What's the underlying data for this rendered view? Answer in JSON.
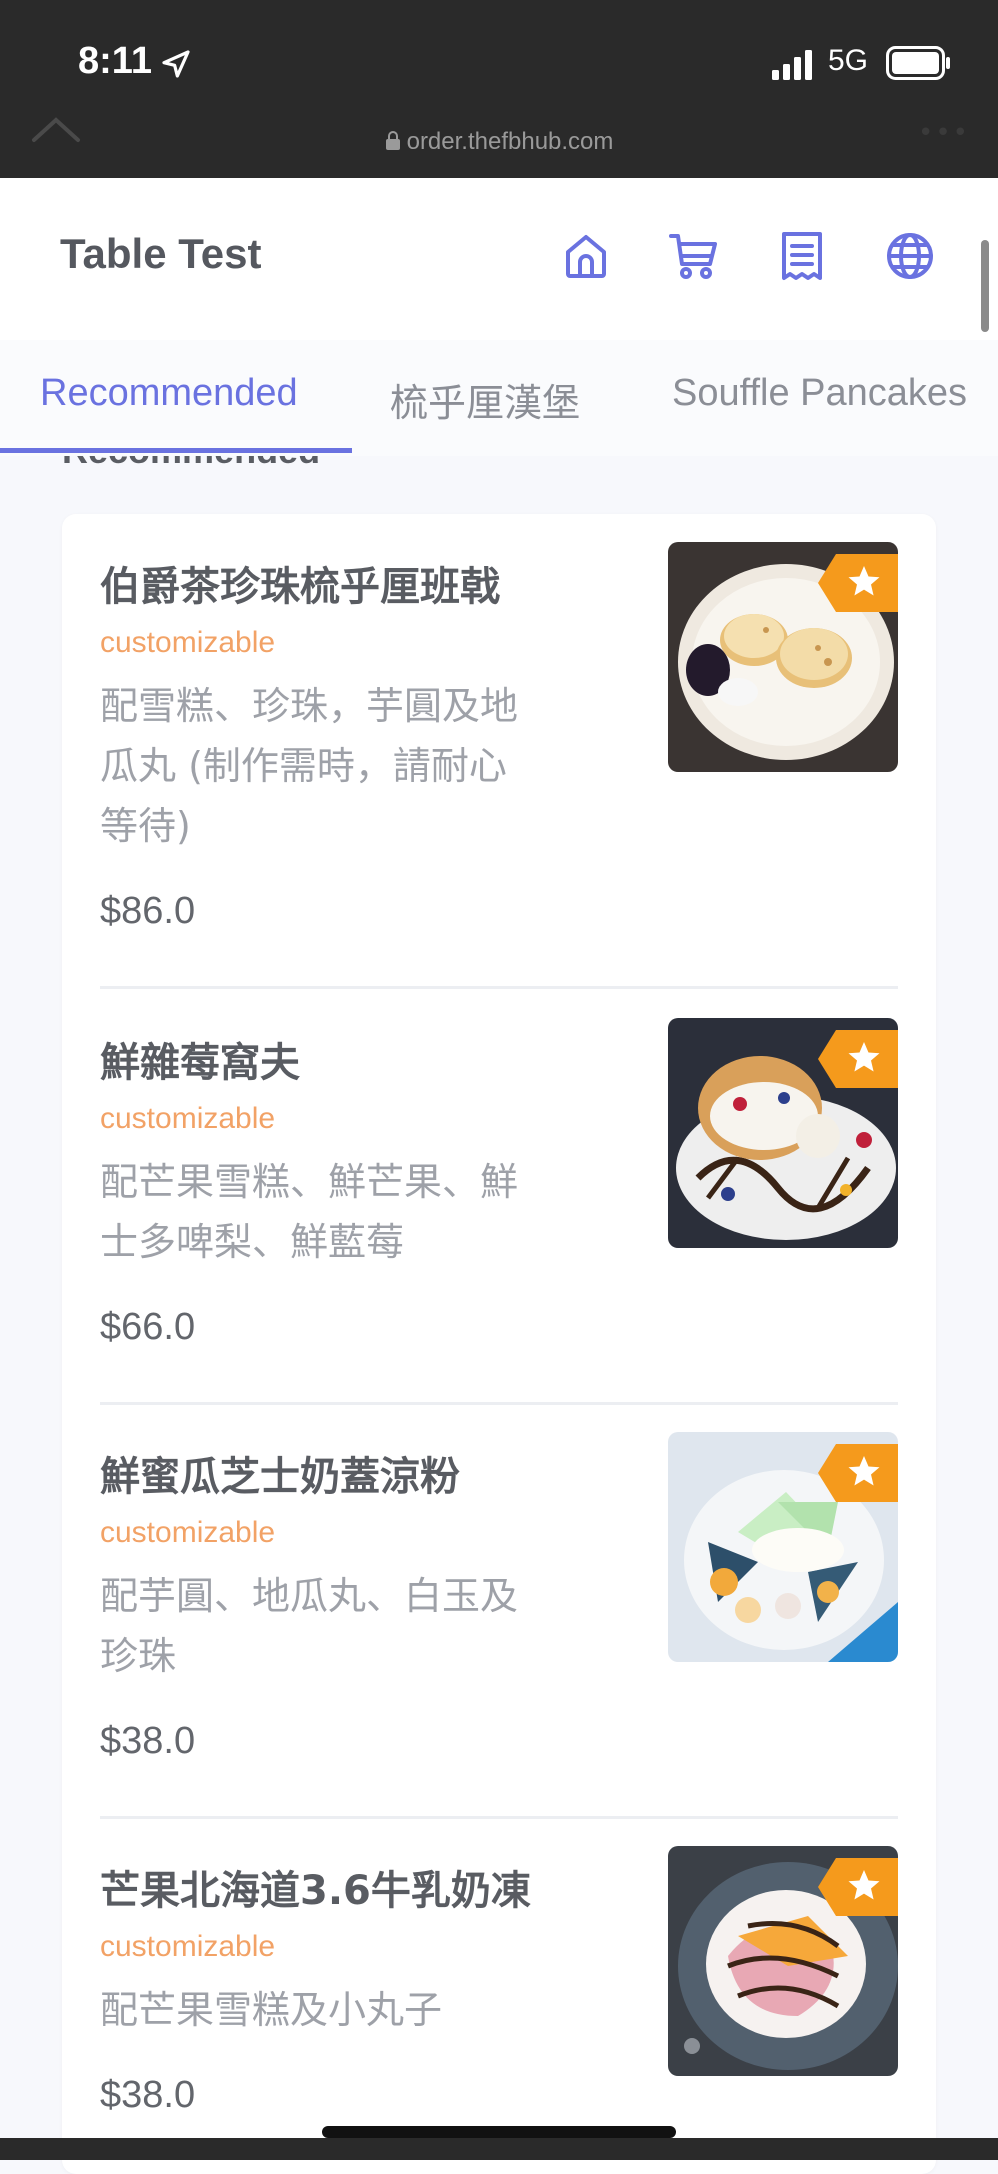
{
  "status_bar": {
    "time": "8:11",
    "network": "5G"
  },
  "browser": {
    "url": "order.thefbhub.com"
  },
  "header": {
    "title": "Table Test",
    "icons": [
      "home-icon",
      "cart-icon",
      "receipt-icon",
      "globe-icon"
    ]
  },
  "tabs": [
    {
      "label": "Recommended",
      "active": true
    },
    {
      "label": "梳乎厘漢堡",
      "active": false
    },
    {
      "label": "Souffle Pancakes",
      "active": false
    }
  ],
  "section_title": "Recommended",
  "items": [
    {
      "name": "伯爵茶珍珠梳乎厘班戟",
      "tag": "customizable",
      "desc_lines": [
        "配雪糕、珍珠，芋圓及地",
        "瓜丸 (制作需時，請耐心",
        "等待)"
      ],
      "price": "$86.0"
    },
    {
      "name": "鮮雜莓窩夫",
      "tag": "customizable",
      "desc_lines": [
        "配芒果雪糕、鮮芒果、鮮",
        "士多啤梨、鮮藍莓"
      ],
      "price": "$66.0"
    },
    {
      "name": "鮮蜜瓜芝士奶蓋涼粉",
      "tag": "customizable",
      "desc_lines": [
        "配芋圓、地瓜丸、白玉及",
        "珍珠"
      ],
      "price": "$38.0"
    },
    {
      "name": "芒果北海道3.6牛乳奶凍",
      "tag": "customizable",
      "desc_lines": [
        "配芒果雪糕及小丸子"
      ],
      "price": "$38.0"
    }
  ],
  "colors": {
    "accent": "#6a72e0",
    "tag": "#f2a266",
    "badge": "#f59a1c"
  }
}
